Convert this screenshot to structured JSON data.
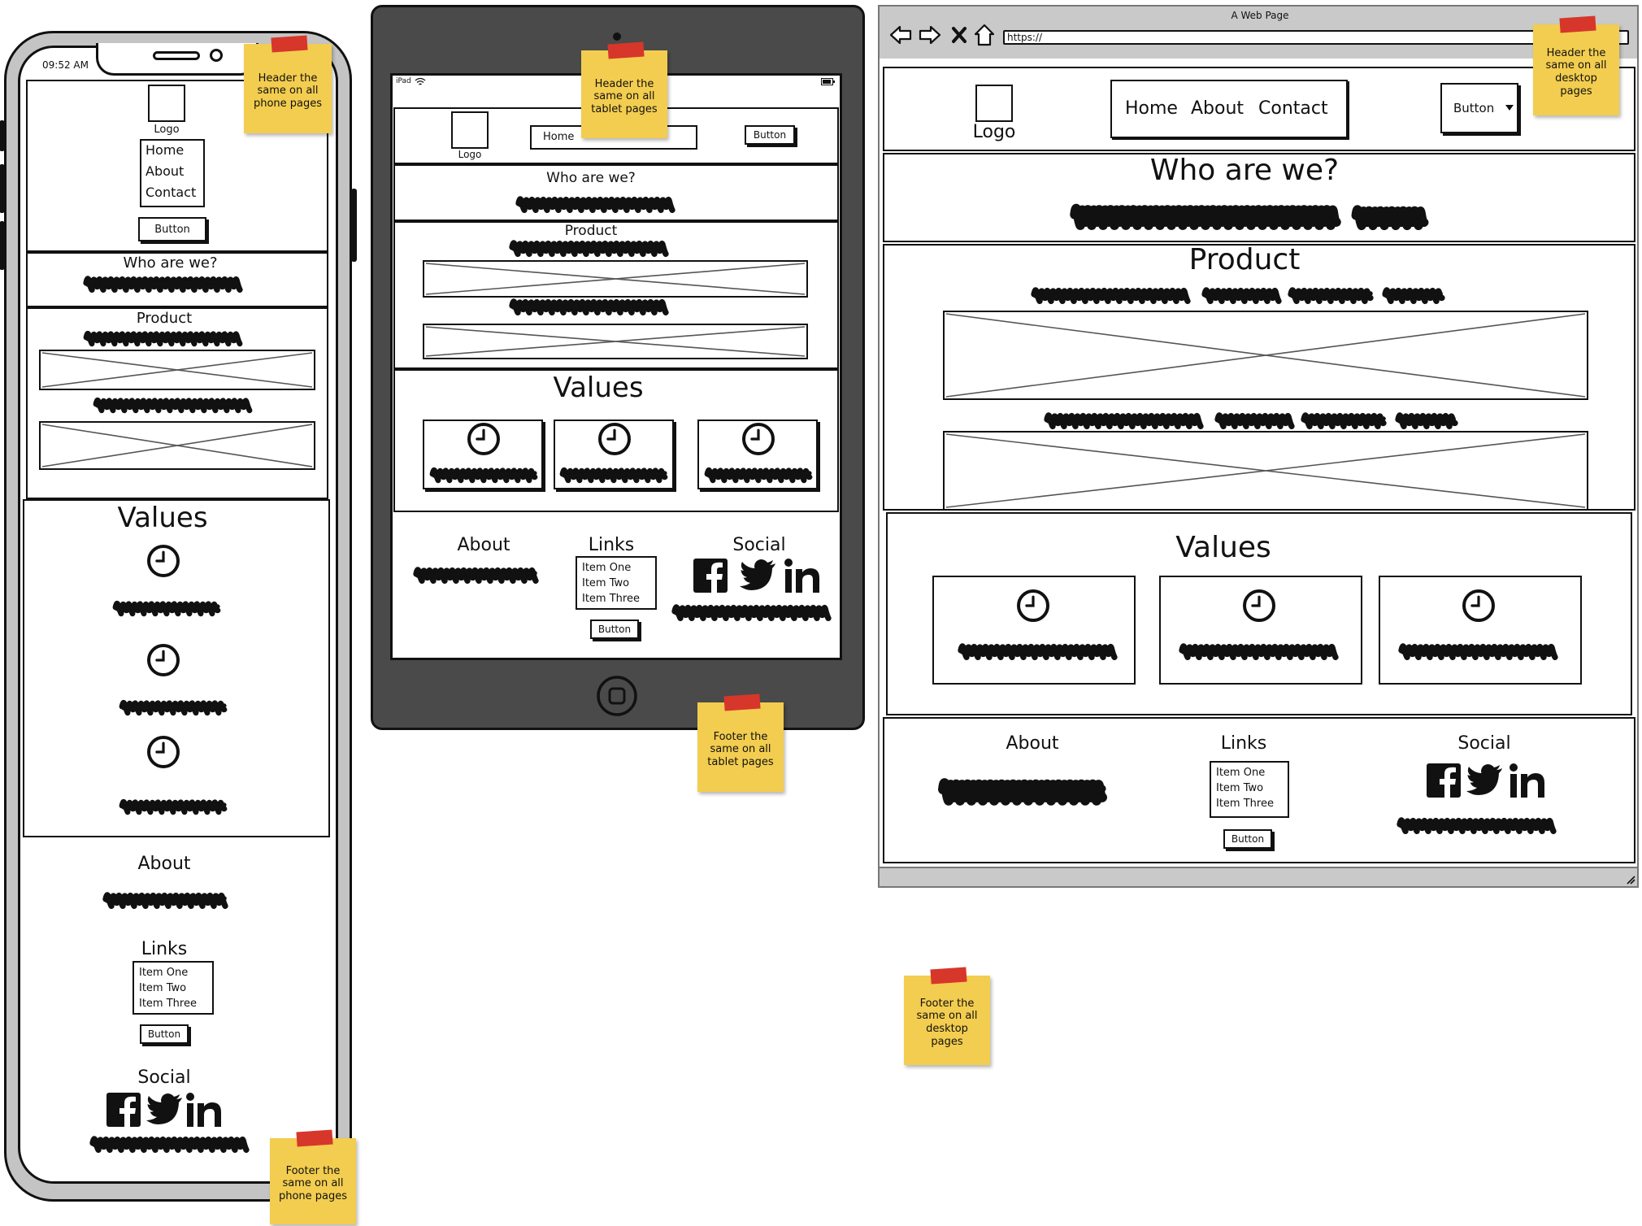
{
  "phone": {
    "status_time": "09:52 AM",
    "logo_label": "Logo",
    "nav": [
      "Home",
      "About",
      "Contact"
    ],
    "button_label": "Button",
    "who_heading": "Who are we?",
    "product_heading": "Product",
    "values_heading": "Values",
    "about_heading": "About",
    "links_heading": "Links",
    "links_items": [
      "Item One",
      "Item Two",
      "Item Three"
    ],
    "links_button": "Button",
    "social_heading": "Social"
  },
  "tablet": {
    "status_carrier": "iPad",
    "logo_label": "Logo",
    "nav_visible": "Home",
    "button_label": "Button",
    "who_heading": "Who are we?",
    "product_heading": "Product",
    "values_heading": "Values",
    "about_heading": "About",
    "links_heading": "Links",
    "links_items": [
      "Item One",
      "Item Two",
      "Item Three"
    ],
    "links_button": "Button",
    "social_heading": "Social"
  },
  "desktop": {
    "window_title": "A Web Page",
    "url": "https://",
    "logo_label": "Logo",
    "nav": [
      "Home",
      "About",
      "Contact"
    ],
    "dropdown_label": "Button",
    "who_heading": "Who are we?",
    "product_heading": "Product",
    "values_heading": "Values",
    "about_heading": "About",
    "links_heading": "Links",
    "links_items": [
      "Item One",
      "Item Two",
      "Item Three"
    ],
    "links_button": "Button",
    "social_heading": "Social"
  },
  "notes": {
    "phone_header": "Header the\nsame on all\nphone pages",
    "phone_footer": "Footer the\nsame on all\nphone pages",
    "tablet_header": "Header the\nsame on all\ntablet pages",
    "tablet_footer": "Footer the\nsame on all\ntablet pages",
    "desktop_header": "Header the\nsame on all\ndesktop\npages",
    "desktop_footer": "Footer the\nsame on all\ndesktop\npages"
  },
  "colors": {
    "sticky_note": "#f3cd4f",
    "sticky_tape": "#d7362b",
    "tablet_frame": "#4a4a4a",
    "browser_chrome": "#c9c9c9",
    "ink": "#111111"
  },
  "icons": [
    "clock-icon",
    "facebook-icon",
    "twitter-icon",
    "linkedin-icon",
    "image-placeholder",
    "back-arrow-icon",
    "forward-arrow-icon",
    "close-x-icon",
    "home-icon",
    "home-button-icon",
    "dropdown-caret-icon",
    "wifi-icon",
    "battery-icon"
  ]
}
